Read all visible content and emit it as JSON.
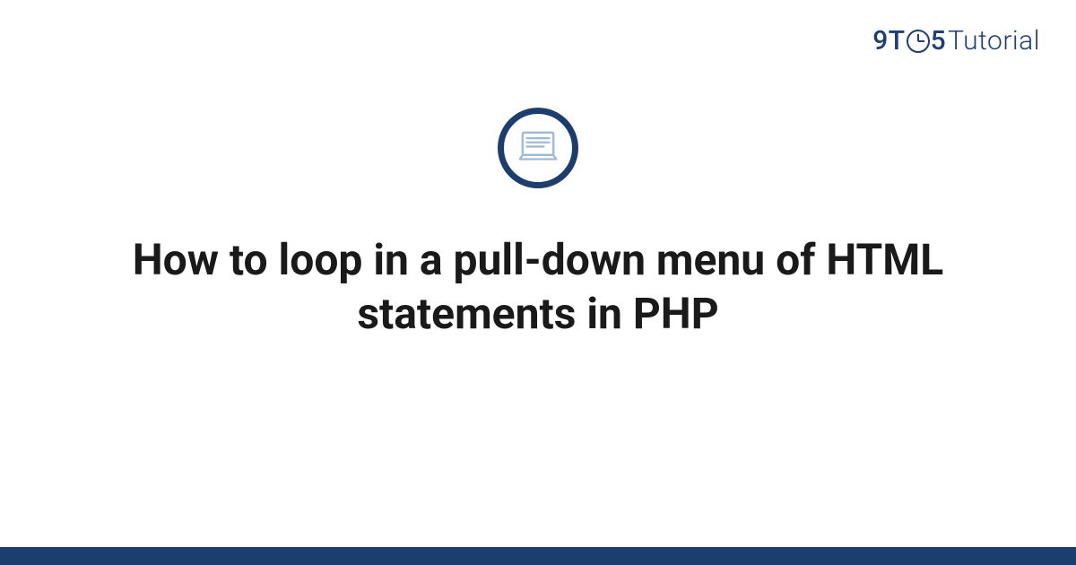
{
  "brand": {
    "part1": "9T",
    "part2": "5",
    "part3": "Tutorial"
  },
  "article": {
    "title": "How to loop in a pull-down menu of HTML statements in PHP"
  },
  "icon": {
    "name": "laptop-document-icon"
  },
  "colors": {
    "brand_text": "#1d3e78",
    "accent": "#1c3e6e",
    "icon_stroke": "#9fb9dd",
    "title_text": "#1a1a1a"
  }
}
